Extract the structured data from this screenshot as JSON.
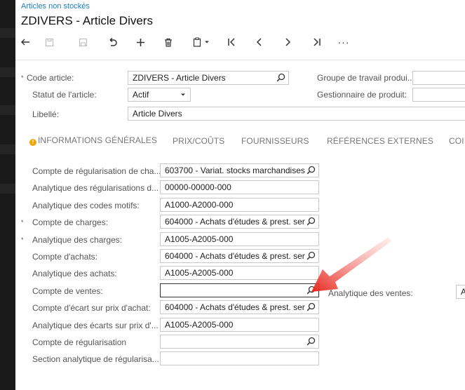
{
  "header": {
    "breadcrumb": "Articles non stockés",
    "title": "ZDIVERS - Article Divers",
    "toolbar": {
      "back": "↶",
      "more": "···"
    }
  },
  "top_form": {
    "code_label": "Code article:",
    "code_value": "ZDIVERS - Article Divers",
    "status_label": "Statut de l'article:",
    "status_value": "Actif",
    "desc_label": "Libellé:",
    "desc_value": "Article Divers",
    "workgroup_label": "Groupe de travail produi...",
    "workgroup_value": "",
    "manager_label": "Gestionnaire de produit:",
    "manager_value": ""
  },
  "tabs": [
    {
      "label": "INFORMATIONS GÉNÉRALES",
      "warning": true
    },
    {
      "label": "PRIX/COÛTS"
    },
    {
      "label": "FOURNISSEURS"
    },
    {
      "label": "RÉFÉRENCES EXTERNES"
    },
    {
      "label": "COI"
    }
  ],
  "fields": [
    {
      "label": "Compte de régularisation de cha...",
      "value": "603700 - Variat. stocks marchandises",
      "lookup": true,
      "required": false
    },
    {
      "label": "Analytique des régularisations d...",
      "value": "00000-00000-000",
      "lookup": false,
      "required": false
    },
    {
      "label": "Analytique des codes motifs:",
      "value": "A1000-A2000-000",
      "lookup": false,
      "required": false
    },
    {
      "label": "Compte de charges:",
      "value": "604000 - Achats d'études & prest. ser",
      "lookup": true,
      "required": true
    },
    {
      "label": "Analytique des charges:",
      "value": "A1005-A2005-000",
      "lookup": false,
      "required": true
    },
    {
      "label": "Compte d'achats:",
      "value": "604000 - Achats d'études & prest. ser",
      "lookup": true,
      "required": false
    },
    {
      "label": "Analytique des achats:",
      "value": "A1005-A2005-000",
      "lookup": false,
      "required": false
    },
    {
      "label": "Compte de ventes:",
      "value": "",
      "lookup": true,
      "required": false,
      "active": true
    },
    {
      "label": "Compte d'écart sur prix d'achat:",
      "value": "604000 - Achats d'études & prest. ser",
      "lookup": true,
      "required": false
    },
    {
      "label": "Analytique des écarts sur prix d'...",
      "value": "A1005-A2005-000",
      "lookup": false,
      "required": false
    },
    {
      "label": "Compte de régularisation",
      "value": "",
      "lookup": true,
      "required": false
    },
    {
      "label": "Section analytique de régularisa...",
      "value": "",
      "lookup": false,
      "required": false
    }
  ],
  "sales_analytic": {
    "label": "Analytique des ventes:",
    "value": "A"
  },
  "required_marker": "*",
  "colors": {
    "link": "#1e7fc2",
    "arrow": "#e8251c",
    "warning": "#f0a500"
  }
}
